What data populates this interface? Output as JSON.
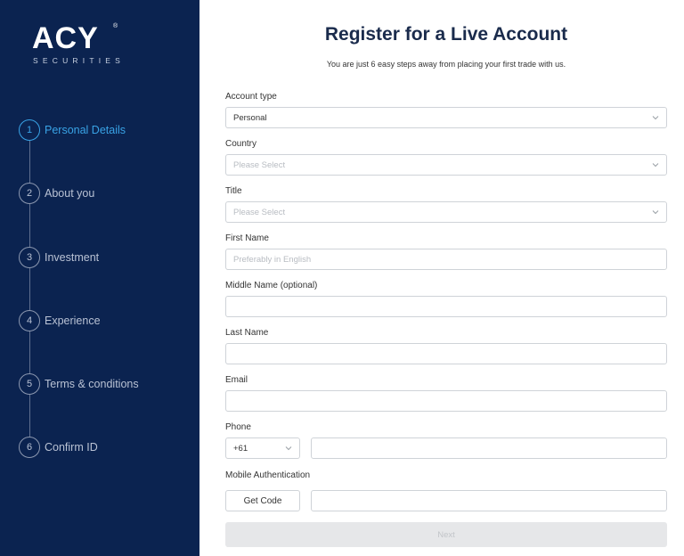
{
  "brand": {
    "name": "ACY",
    "registered": "®",
    "tagline": "SECURITIES"
  },
  "steps": [
    {
      "number": "1",
      "label": "Personal Details",
      "active": true
    },
    {
      "number": "2",
      "label": "About you",
      "active": false
    },
    {
      "number": "3",
      "label": "Investment",
      "active": false
    },
    {
      "number": "4",
      "label": "Experience",
      "active": false
    },
    {
      "number": "5",
      "label": "Terms & conditions",
      "active": false
    },
    {
      "number": "6",
      "label": "Confirm ID",
      "active": false
    }
  ],
  "header": {
    "title": "Register for a Live Account",
    "subtitle": "You are just 6 easy steps away from placing your first trade with us."
  },
  "form": {
    "account_type": {
      "label": "Account type",
      "value": "Personal"
    },
    "country": {
      "label": "Country",
      "placeholder": "Please Select"
    },
    "title": {
      "label": "Title",
      "placeholder": "Please Select"
    },
    "first_name": {
      "label": "First Name",
      "placeholder": "Preferably in English"
    },
    "middle_name": {
      "label": "Middle Name (optional)",
      "value": ""
    },
    "last_name": {
      "label": "Last Name",
      "value": ""
    },
    "email": {
      "label": "Email",
      "value": ""
    },
    "phone": {
      "label": "Phone",
      "code": "+61",
      "value": ""
    },
    "mobile_auth": {
      "label": "Mobile Authentication",
      "button": "Get Code",
      "value": ""
    },
    "next_button": "Next"
  },
  "colors": {
    "sidebar_bg": "#0b2350",
    "active_step": "#39a3e6",
    "title": "#1a2b4c"
  }
}
